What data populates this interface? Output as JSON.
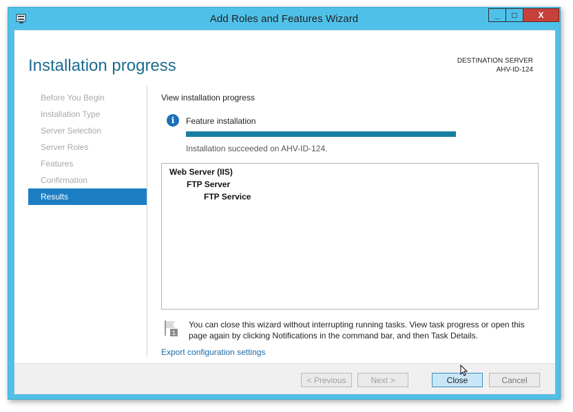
{
  "window": {
    "title": "Add Roles and Features Wizard",
    "controls": {
      "minimize": "_",
      "maximize": "□",
      "close": "X"
    }
  },
  "header": {
    "page_title": "Installation progress",
    "destination_label": "DESTINATION SERVER",
    "destination_server": "AHV-ID-124"
  },
  "nav": {
    "items": [
      {
        "label": "Before You Begin"
      },
      {
        "label": "Installation Type"
      },
      {
        "label": "Server Selection"
      },
      {
        "label": "Server Roles"
      },
      {
        "label": "Features"
      },
      {
        "label": "Confirmation"
      },
      {
        "label": "Results"
      }
    ],
    "active_index": 6
  },
  "main": {
    "view_progress_label": "View installation progress",
    "feature_installation_label": "Feature installation",
    "progress_fraction": 1.0,
    "status_text": "Installation succeeded on AHV-ID-124.",
    "results_tree": [
      {
        "label": "Web Server (IIS)"
      },
      {
        "label": "FTP Server"
      },
      {
        "label": "FTP Service"
      }
    ],
    "notice_text": "You can close this wizard without interrupting running tasks. View task progress or open this page again by clicking Notifications in the command bar, and then Task Details.",
    "export_link": "Export configuration settings"
  },
  "footer": {
    "previous_label": "< Previous",
    "next_label": "Next >",
    "close_label": "Close",
    "cancel_label": "Cancel"
  },
  "colors": {
    "title_bar": "#4fc1e9",
    "accent": "#1c7fc4",
    "progress": "#1780a1",
    "close_button": "#c7413a"
  }
}
